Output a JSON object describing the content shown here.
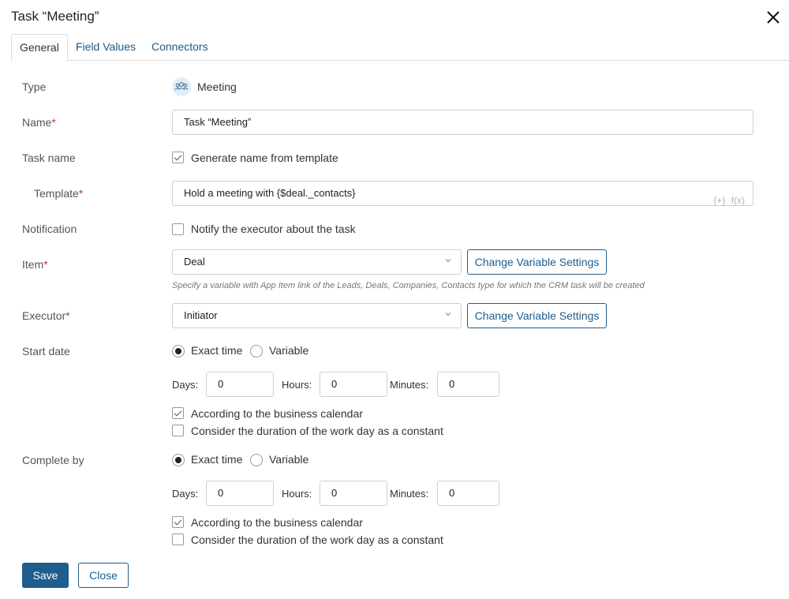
{
  "dialog": {
    "title": "Task “Meeting”"
  },
  "tabs": [
    {
      "label": "General"
    },
    {
      "label": "Field Values"
    },
    {
      "label": "Connectors"
    }
  ],
  "form": {
    "type": {
      "label": "Type",
      "value": "Meeting",
      "icon": "people-group-icon"
    },
    "name": {
      "label": "Name",
      "value": "Task “Meeting”"
    },
    "task_name": {
      "label": "Task name",
      "checkbox_label": "Generate name from template",
      "checked": true
    },
    "template": {
      "label": "Template",
      "value": "Hold a meeting with {$deal._contacts}",
      "insert_icon": "{+}",
      "function_icon": "f(x)"
    },
    "notification": {
      "label": "Notification",
      "checkbox_label": "Notify the executor about the task",
      "checked": false
    },
    "item": {
      "label": "Item",
      "value": "Deal",
      "button_label": "Change Variable Settings",
      "hint": "Specify a variable with App Item link of the Leads, Deals, Companies, Contacts type for which the CRM task will be created"
    },
    "executor": {
      "label": "Executor",
      "value": "Initiator",
      "button_label": "Change Variable Settings"
    },
    "start_date": {
      "label": "Start date",
      "radio_exact": "Exact time",
      "radio_variable": "Variable",
      "selected": "Exact time",
      "days_label": "Days:",
      "days": "0",
      "hours_label": "Hours:",
      "hours": "0",
      "minutes_label": "Minutes:",
      "minutes": "0",
      "business_calendar": "According to the business calendar",
      "business_calendar_checked": true,
      "workday_constant": "Consider the duration of the work day as a constant",
      "workday_constant_checked": false
    },
    "complete_by": {
      "label": "Complete by",
      "radio_exact": "Exact time",
      "radio_variable": "Variable",
      "selected": "Exact time",
      "days_label": "Days:",
      "days": "0",
      "hours_label": "Hours:",
      "hours": "0",
      "minutes_label": "Minutes:",
      "minutes": "0",
      "business_calendar": "According to the business calendar",
      "business_calendar_checked": true,
      "workday_constant": "Consider the duration of the work day as a constant",
      "workday_constant_checked": false
    },
    "required_mark": "*"
  },
  "footer": {
    "save_label": "Save",
    "close_label": "Close"
  },
  "colors": {
    "accent": "#1f5d8c",
    "required": "#c0392b",
    "icon_bg": "#e1edf7"
  }
}
